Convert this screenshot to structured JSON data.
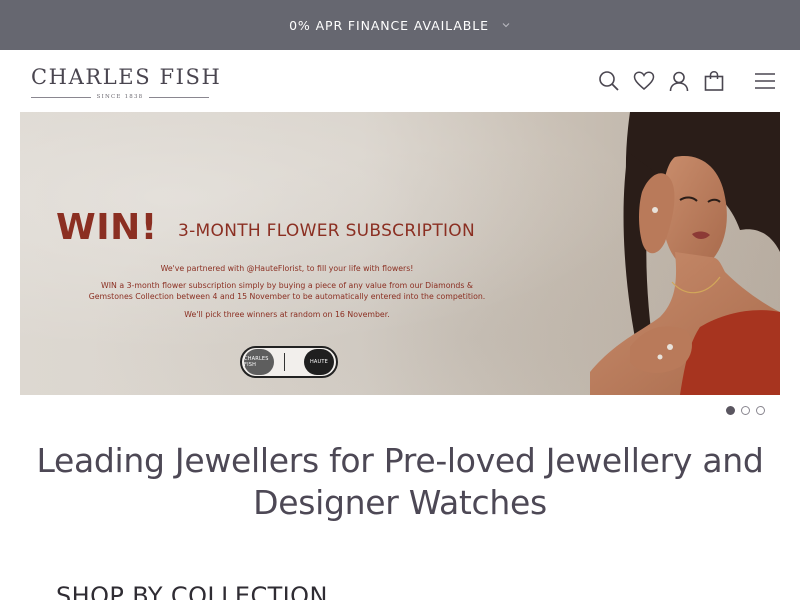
{
  "promo": {
    "text": "0% APR FINANCE AVAILABLE",
    "chevron_icon": "chevron-down-icon"
  },
  "header": {
    "logo": {
      "name": "CHARLES FISH",
      "since": "SINCE 1838"
    },
    "icons": [
      "search-icon",
      "heart-icon",
      "account-icon",
      "bag-icon",
      "menu-icon"
    ]
  },
  "hero": {
    "win": "WIN!",
    "subtitle": "3-MONTH FLOWER SUBSCRIPTION",
    "copy_line1": "We've partnered with @HauteFlorist, to fill your life with flowers!",
    "copy_line2a": "WIN a 3-month flower subscription simply by buying a piece of any value from our Diamonds &",
    "copy_line2b": "Gemstones Collection between 4 and 15 November to be automatically entered into the competition.",
    "copy_line3": "We'll pick three winners at random on 16 November.",
    "badge_left": "CHARLES FISH",
    "badge_right": "HAUTE",
    "accent_color": "#8b2f22"
  },
  "carousel": {
    "slide_count": 3,
    "active_index": 0
  },
  "headline": {
    "line1": "Leading Jewellers for Pre-loved Jewellery and",
    "line2": "Designer Watches"
  },
  "section": {
    "title": "SHOP BY COLLECTION"
  },
  "colors": {
    "promo_bg": "#666770",
    "text": "#4a4650"
  }
}
